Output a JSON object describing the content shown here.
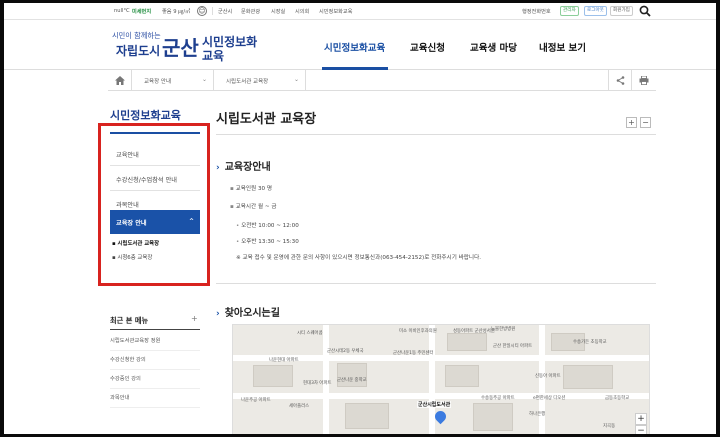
{
  "topbar": {
    "weather": "null°C",
    "dust_label": "미세먼지",
    "dust_value": "좋음 9 ㎍/㎥",
    "links": [
      "군산시",
      "문화관광",
      "시장실",
      "시의회",
      "시민정보화교육"
    ],
    "org_chart": "행정전화번호",
    "login": "관리자",
    "logout": "로그아웃",
    "my_info": "회원가입"
  },
  "logo": {
    "slogan": "시민이 함께하는",
    "city": "자립도시",
    "brand": "군산",
    "site_line1": "시민정보화",
    "site_line2": "교육"
  },
  "gnb": [
    "시민정보화교육",
    "교육신청",
    "교육생 마당",
    "내정보 보기"
  ],
  "breadcrumb": {
    "level1": "교육장 안내",
    "level2": "시립도서관 교육장"
  },
  "sidebar": {
    "title": "시민정보화교육",
    "items": [
      "교육안내",
      "수강신청/수업참석 안내",
      "과목안내",
      "교육장 안내"
    ],
    "caret": "^",
    "subitems": [
      "시립도서관 교육장",
      "시청6층 교육장"
    ],
    "recent_title": "최근 본 메뉴",
    "recent_plus": "+",
    "recent_items": [
      "시립도서관교육장 정원",
      "수강신청한 강의",
      "수강중인 강의",
      "과목안내"
    ]
  },
  "content": {
    "title": "시립도서관 교육장",
    "zoom_in": "+",
    "zoom_out": "−",
    "section1": "교육장안내",
    "capacity_label": "교육인원",
    "capacity_value": "30 명",
    "time_label": "교육시간",
    "time_value": "월 ~ 금",
    "am": "오전반 10:00 ~ 12:00",
    "pm": "오후반 13:30 ~ 15:30",
    "note": "※ 교육 접수 및 운영에 관한 문의 사항이 있으시면 정보통신과(063-454-2152)로 전화주시기 바랍니다.",
    "section2": "찾아오시는길"
  },
  "map": {
    "place": "군산시립도서관",
    "labels": [
      "시티 스퀘어콤",
      "군산시테2동 우체국",
      "나운현대 아파트",
      "미소 이비인후과의원",
      "성동아파트 군산성서원",
      "노블한방병원",
      "군산나운1동 주민센터",
      "현대3차 아파트",
      "군산나운 중학교",
      "군산 한일시티 아파트",
      "수송동주공 아파트",
      "수송가든 초등학교",
      "세아플러스",
      "하나은행",
      "e편한세상 디오션",
      "금동초등학교",
      "나운주공 아파트",
      "지곡동",
      "신동아 아파트"
    ],
    "zoom_in": "+",
    "zoom_out": "−"
  }
}
